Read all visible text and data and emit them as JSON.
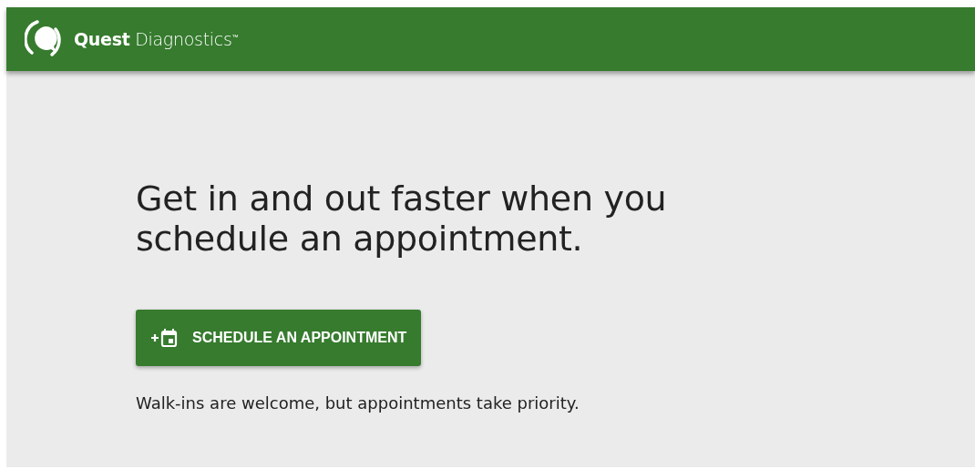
{
  "header": {
    "logo_text": "**Quest** Diagnostics$^{™}$"
  },
  "hero": {
    "headline": "Get in and out faster when you schedule an appointment.",
    "button": "SCHEDULE AN APPOINTMENT",
    "note": "Walk-ins are welcome, but appointments take priority."
  }
}
